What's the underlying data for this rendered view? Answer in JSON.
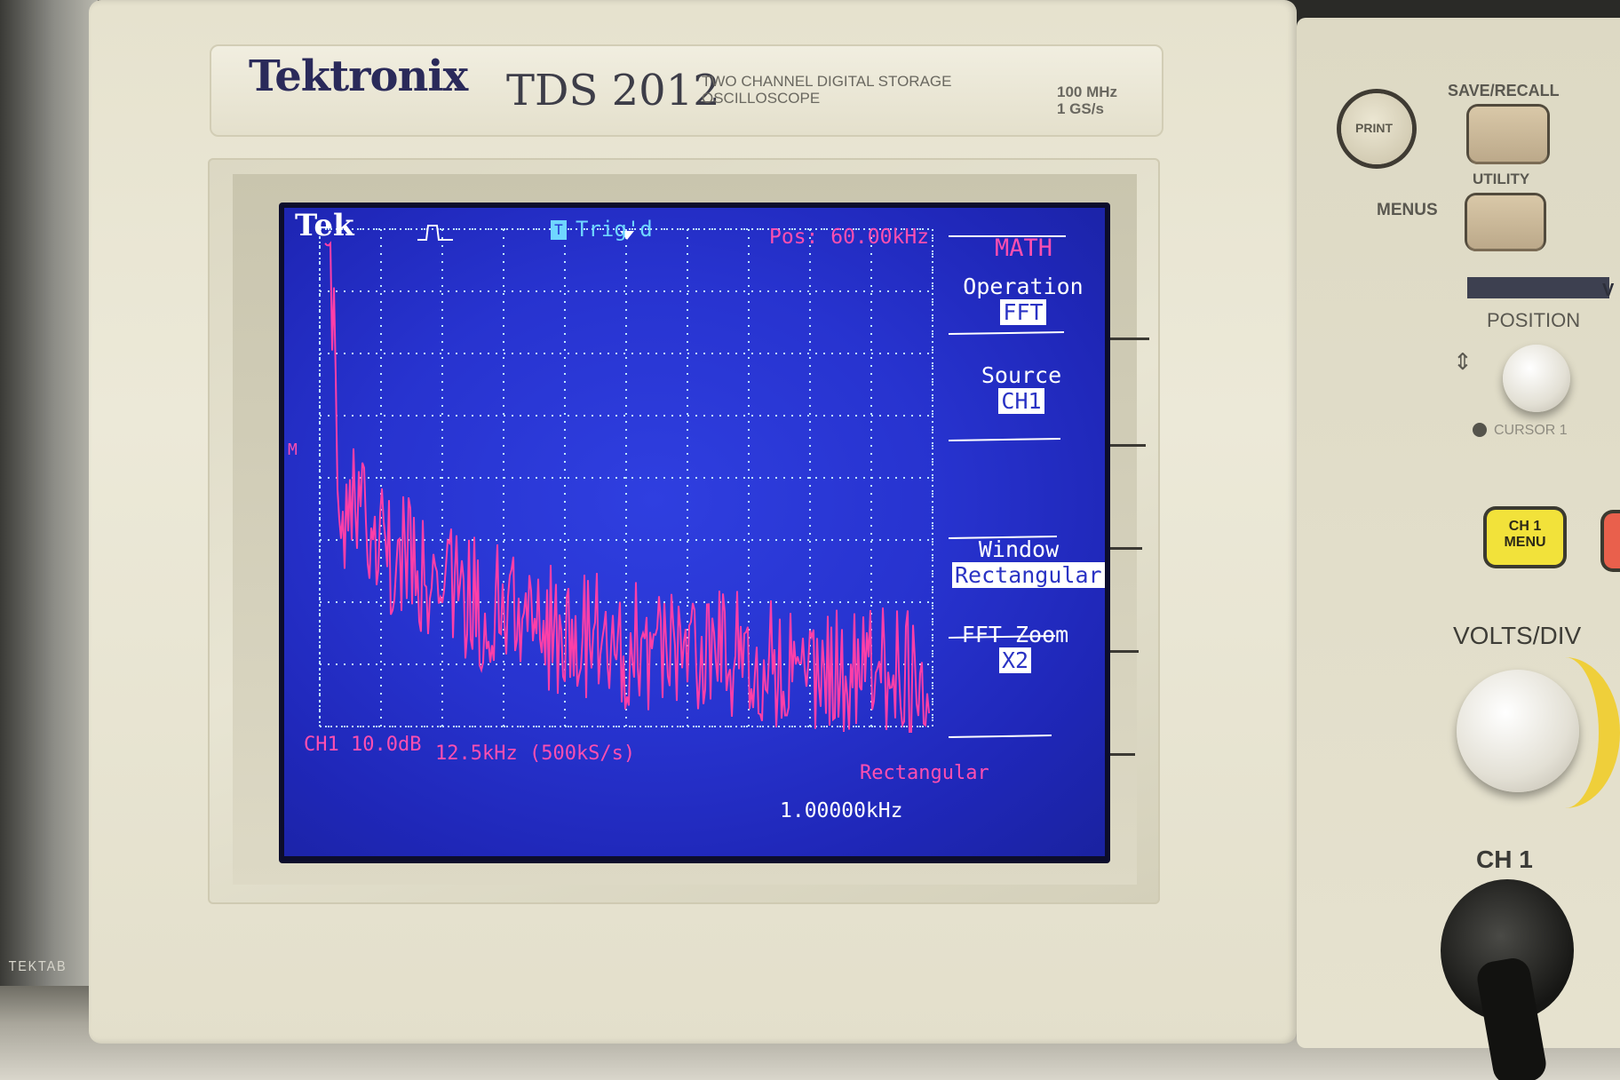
{
  "device": {
    "brand": "Tektronix",
    "model": "TDS 2012",
    "description": "TWO CHANNEL DIGITAL STORAGE OSCILLOSCOPE",
    "specs": [
      "100 MHz",
      "1 GS/s"
    ],
    "rack_label": "TEKTAB"
  },
  "screen": {
    "logo": "Tek",
    "trigger_status": "Trig'd",
    "trigger_box": "T",
    "position": "Pos: 60.00kHz",
    "menu_title": "MATH",
    "menu": [
      {
        "label": "Operation",
        "value": "FFT"
      },
      {
        "label": "Source",
        "value": "CH1"
      },
      {
        "label": "",
        "value": ""
      },
      {
        "label": "Window",
        "value": "Rectangular"
      },
      {
        "label": "FFT Zoom",
        "value": "X2"
      }
    ],
    "ch_scale": "CH1 10.0dB",
    "span": "12.5kHz (500kS/s)",
    "window_label": "Rectangular",
    "frequency": "1.00000kHz",
    "marker": "M"
  },
  "panel": {
    "print_label": "PRINT",
    "save_recall_label": "SAVE/RECALL",
    "utility_label": "UTILITY",
    "menus_label": "MENUS",
    "position_label": "POSITION",
    "cursor_label": "CURSOR 1",
    "ch1_menu_label": "CH 1 MENU",
    "volts_div_label": "VOLTS/DIV",
    "ch1_label": "CH 1",
    "vertical_label": "V"
  },
  "colors": {
    "screen_blue": "#2733cf",
    "trace_magenta": "#ff3fa8",
    "bezel_cream": "#ece9d8",
    "ch1_button": "#f2e23a"
  }
}
